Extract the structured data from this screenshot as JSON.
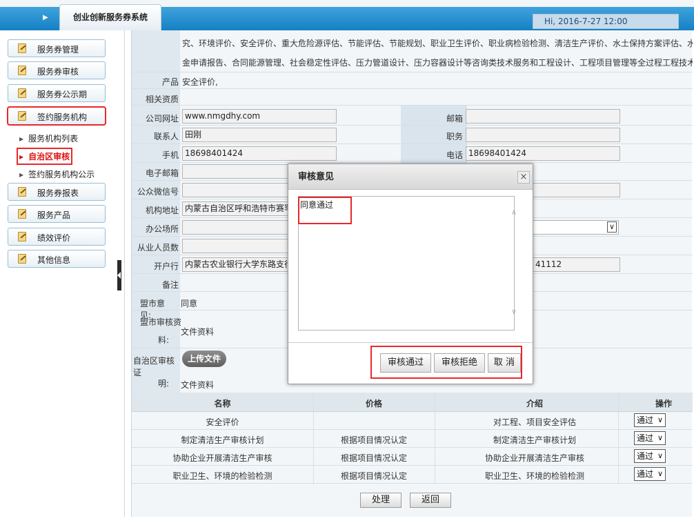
{
  "header": {
    "app_title": "创业创新服务券系统",
    "greeting": "Hi, 2016-7-27 12:00"
  },
  "sidebar": {
    "items": [
      {
        "label": "服务券管理"
      },
      {
        "label": "服务券审核"
      },
      {
        "label": "服务券公示期"
      },
      {
        "label": "签约服务机构"
      },
      {
        "label": "服务券报表"
      },
      {
        "label": "服务产品"
      },
      {
        "label": "绩效评价"
      },
      {
        "label": "其他信息"
      }
    ],
    "subitems": [
      {
        "label": "服务机构列表"
      },
      {
        "label": "自治区审核"
      },
      {
        "label": "签约服务机构公示"
      }
    ]
  },
  "form": {
    "scope_line1": "究、环境评价、安全评价、重大危险源评估、节能评估、节能规划、职业卫生评价、职业病检验检测、清洁生产评价、水土保持方案评估、水源论证、资",
    "scope_line2": "金申请报告、合同能源管理、社会稳定性评估、压力管道设计、压力容器设计等咨询类技术服务和工程设计、工程项目管理等全过程工程技术服务。",
    "product_label": "产品",
    "product_value": "安全评价,",
    "qualification_label": "相关资质",
    "website_label": "公司网址",
    "website_value": "www.nmgdhy.com",
    "postcode_label": "邮箱",
    "contact_label": "联系人",
    "contact_value": "田刚",
    "position_label": "职务",
    "mobile_label": "手机",
    "mobile_value": "18698401424",
    "phone_label": "电话",
    "phone_value": "18698401424",
    "email_label": "电子邮箱",
    "wechat_label": "公众微信号",
    "address_label": "机构地址",
    "address_value": "内蒙古自治区呼和浩特市赛罕",
    "office_label": "办公场所",
    "staff_label": "从业人员数",
    "bank_label": "开户行",
    "bank_value": "内蒙古农业银行大学东路支行",
    "account_partial": "41112",
    "remark_label": "备注",
    "league_opinion_label": "盟市意见:",
    "league_opinion_value": "同意",
    "league_material_label_1": "盟市审核资",
    "league_material_label_2": "料:",
    "league_material_value": "文件资料",
    "region_cert_label_1": "自治区审核证",
    "region_cert_label_2": "明:",
    "upload_button": "上传文件",
    "region_cert_value": "文件资料"
  },
  "table": {
    "headers": [
      "名称",
      "价格",
      "介绍",
      "操作"
    ],
    "rows": [
      {
        "name": "安全评价",
        "price": "",
        "intro": "对工程、项目安全评估",
        "op": "通过"
      },
      {
        "name": "制定清洁生产审核计划",
        "price": "根据项目情况认定",
        "intro": "制定清洁生产审核计划",
        "op": "通过"
      },
      {
        "name": "协助企业开展清洁生产审核",
        "price": "根据项目情况认定",
        "intro": "协助企业开展清洁生产审核",
        "op": "通过"
      },
      {
        "name": "职业卫生、环境的检验检测",
        "price": "根据项目情况认定",
        "intro": "职业卫生、环境的检验检测",
        "op": "通过"
      }
    ]
  },
  "actions": {
    "process": "处理",
    "back": "返回"
  },
  "dialog": {
    "title": "审核意见",
    "close": "×",
    "opinion_text": "同意通过",
    "approve": "审核通过",
    "reject": "审核拒绝",
    "cancel": "取 消"
  },
  "icons": {
    "menu": "document-edit-icon",
    "sub": "triangle-right-icon",
    "dropdown": "chevron-down-icon",
    "close": "close-icon"
  },
  "colors": {
    "header_blue": "#1580c4",
    "annotation_red": "#e8282a",
    "active_red": "#d11111"
  }
}
